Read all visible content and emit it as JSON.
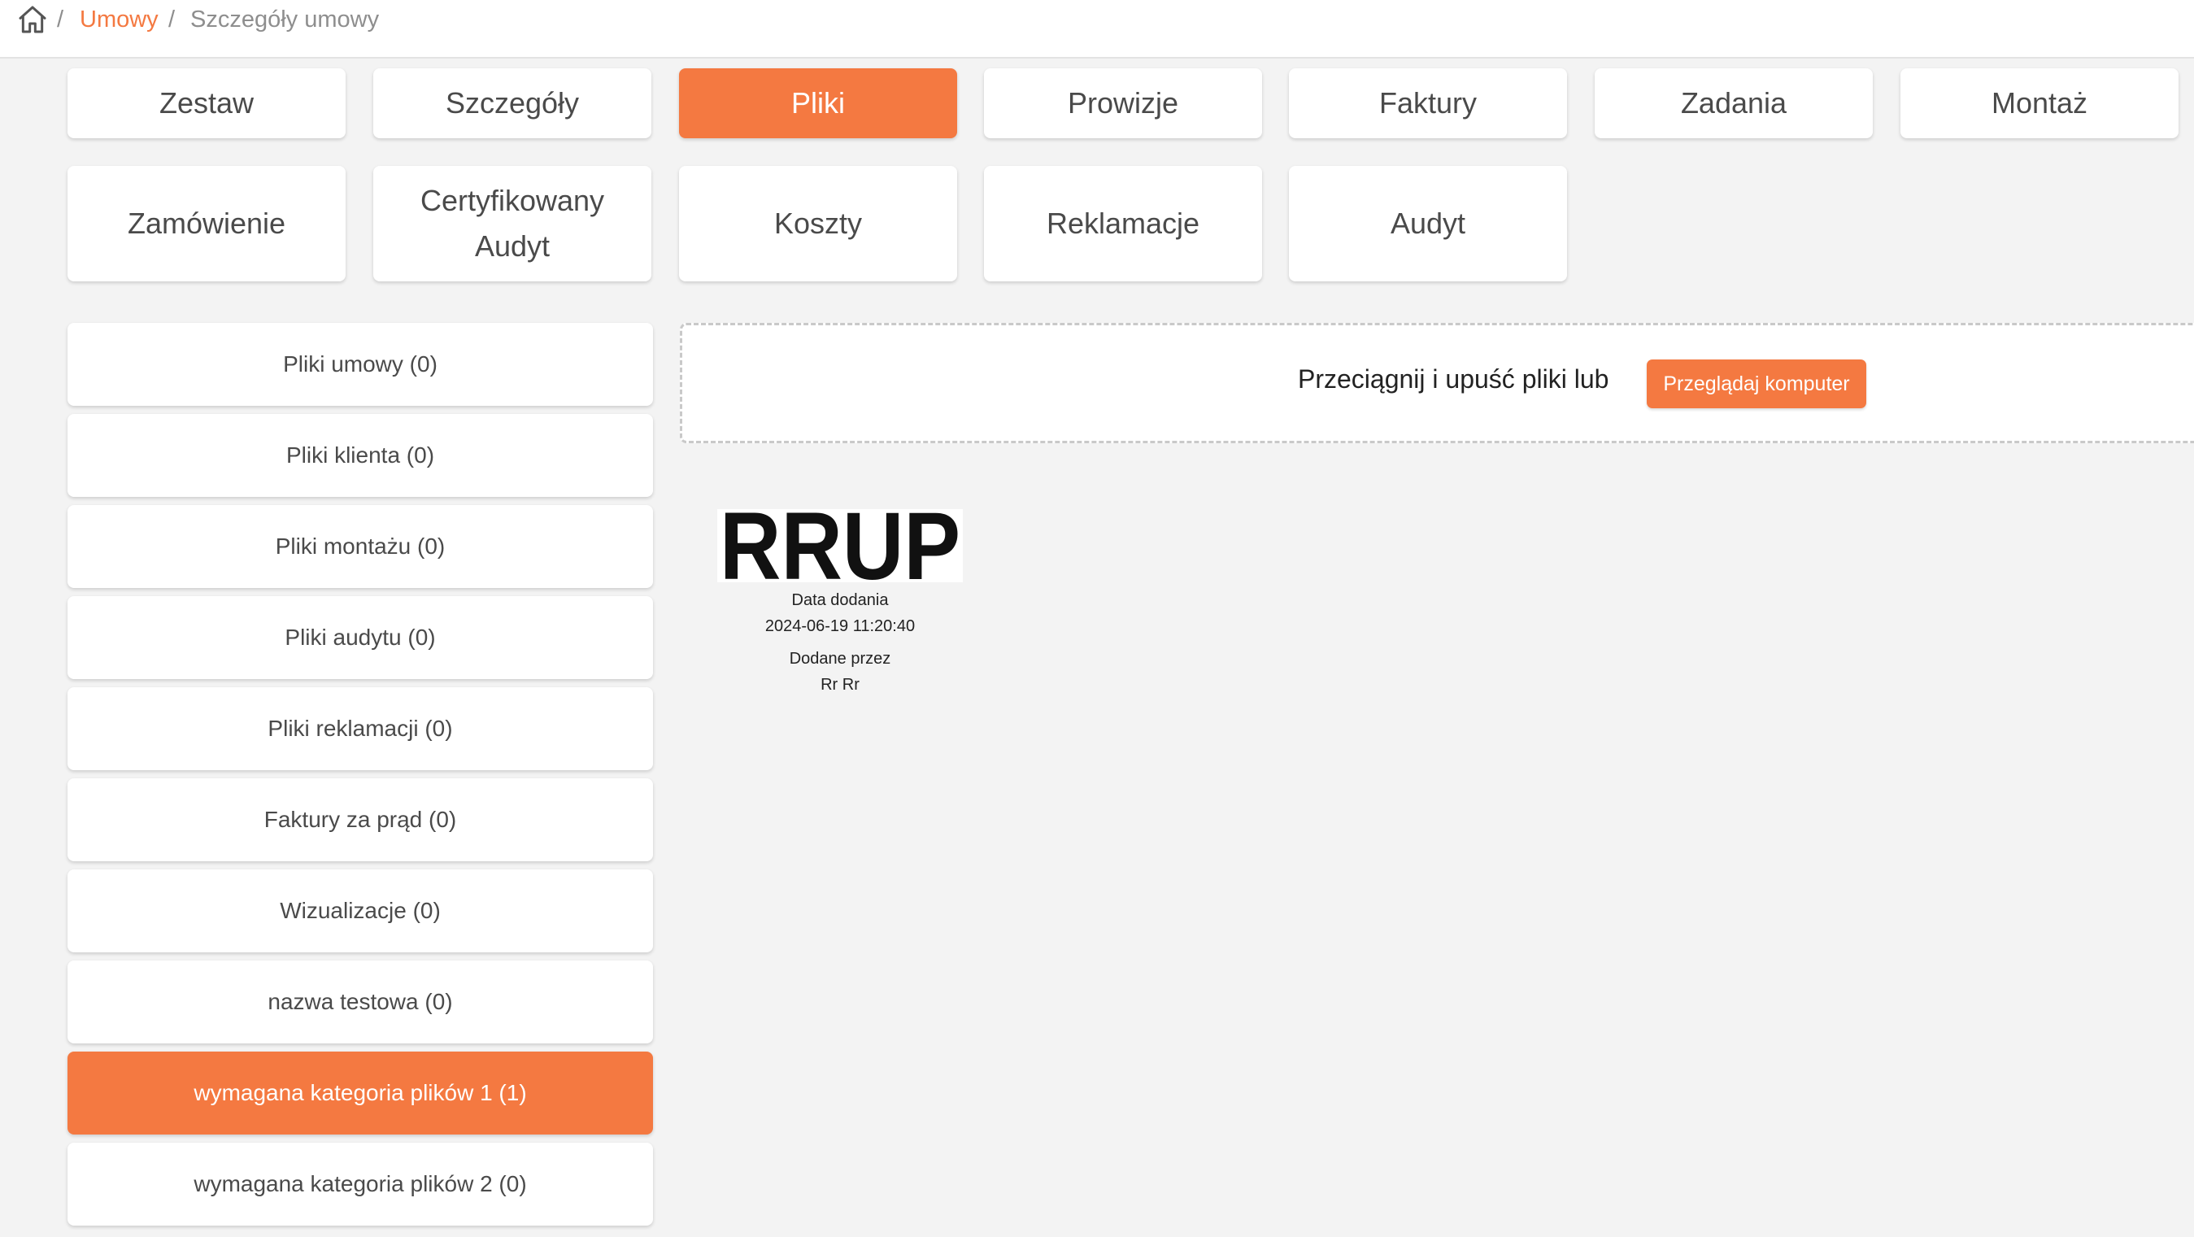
{
  "breadcrumb": {
    "home_icon": "home-icon",
    "separator": "/",
    "link": "Umowy",
    "current": "Szczegóły umowy"
  },
  "tabs_row1": [
    "Zestaw",
    "Szczegóły",
    "Pliki",
    "Prowizje",
    "Faktury",
    "Zadania",
    "Montaż"
  ],
  "tabs_row2": [
    "Zamówienie",
    "Certyfikowany Audyt",
    "Koszty",
    "Reklamacje",
    "Audyt"
  ],
  "active_tab": "Pliki",
  "categories": [
    "Pliki umowy (0)",
    "Pliki klienta (0)",
    "Pliki montażu (0)",
    "Pliki audytu (0)",
    "Pliki reklamacji (0)",
    "Faktury za prąd (0)",
    "Wizualizacje (0)",
    "nazwa testowa (0)",
    "wymagana kategoria plików 1 (1)",
    "wymagana kategoria plików 2 (0)"
  ],
  "active_category": "wymagana kategoria plików 1 (1)",
  "upload": {
    "text": "Przeciągnij i upuść pliki lub",
    "button": "Przeglądaj komputer"
  },
  "file": {
    "logo_text": "RRUP",
    "date_label": "Data dodania",
    "date_value": "2024-06-19 11:20:40",
    "author_label": "Dodane przez",
    "author_value": "Rr Rr"
  },
  "colors": {
    "accent": "#f47941",
    "background": "#f3f3f3"
  }
}
